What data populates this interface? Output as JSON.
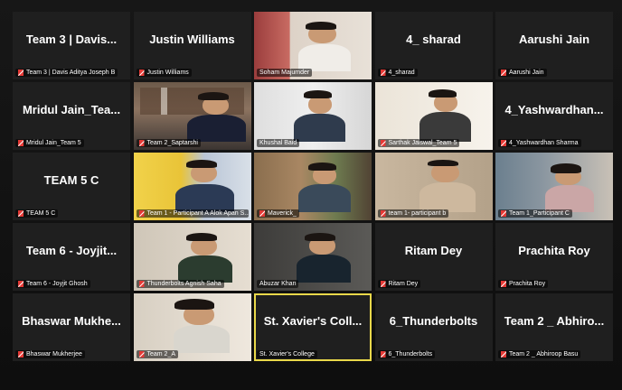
{
  "tiles": [
    {
      "display": "Team 3 | Davis...",
      "label": "Team 3 | Davis Aditya Joseph B",
      "muted": true,
      "video": false
    },
    {
      "display": "Justin Williams",
      "label": "Justin Williams",
      "muted": true,
      "video": false
    },
    {
      "display": "",
      "label": "Soham Majumder",
      "muted": false,
      "video": true
    },
    {
      "display": "4_ sharad",
      "label": "4_sharad",
      "muted": true,
      "video": false
    },
    {
      "display": "Aarushi Jain",
      "label": "Aarushi Jain",
      "muted": true,
      "video": false
    },
    {
      "display": "Mridul Jain_Tea...",
      "label": "Mridul Jain_Team 5",
      "muted": true,
      "video": false
    },
    {
      "display": "",
      "label": "Team 2_Saptarshi",
      "muted": true,
      "video": true
    },
    {
      "display": "",
      "label": "Khushal Baid",
      "muted": false,
      "video": true
    },
    {
      "display": "",
      "label": "Sarthak Jaiswal_Team 5",
      "muted": true,
      "video": true
    },
    {
      "display": "4_Yashwardhan...",
      "label": "4_Yashwardhan Sharma",
      "muted": true,
      "video": false
    },
    {
      "display": "TEAM 5 C",
      "label": "TEAM 5 C",
      "muted": true,
      "video": false
    },
    {
      "display": "",
      "label": "Team 1 - Participant A Alok Apan S...",
      "muted": true,
      "video": true
    },
    {
      "display": "",
      "label": "Maverick_",
      "muted": true,
      "video": true
    },
    {
      "display": "",
      "label": "team 1- participant b",
      "muted": true,
      "video": true
    },
    {
      "display": "",
      "label": "Team 1_Participant C",
      "muted": true,
      "video": true
    },
    {
      "display": "Team 6 - Joyjit...",
      "label": "Team 6 - Joyjit Ghosh",
      "muted": true,
      "video": false
    },
    {
      "display": "",
      "label": "Thunderbolts Agnish Saha",
      "muted": true,
      "video": true
    },
    {
      "display": "",
      "label": "Abuzar Khan",
      "muted": false,
      "video": true
    },
    {
      "display": "Ritam Dey",
      "label": "Ritam Dey",
      "muted": true,
      "video": false
    },
    {
      "display": "Prachita Roy",
      "label": "Prachita Roy",
      "muted": true,
      "video": false
    },
    {
      "display": "Bhaswar Mukhe...",
      "label": "Bhaswar Mukherjee",
      "muted": true,
      "video": false
    },
    {
      "display": "",
      "label": "Team 2_A",
      "muted": true,
      "video": true
    },
    {
      "display": "St. Xavier's Coll...",
      "label": "St. Xavier's College",
      "muted": false,
      "video": false,
      "active": true
    },
    {
      "display": "6_Thunderbolts",
      "label": "6_Thunderbolts",
      "muted": true,
      "video": false
    },
    {
      "display": "Team 2 _ Abhiro...",
      "label": "Team 2 _ Abhiroop Basu",
      "muted": true,
      "video": false
    }
  ],
  "colors": {
    "tile_bg": "#1f1f1f",
    "active_border": "#e9d84a",
    "muted_icon": "#e53935"
  }
}
